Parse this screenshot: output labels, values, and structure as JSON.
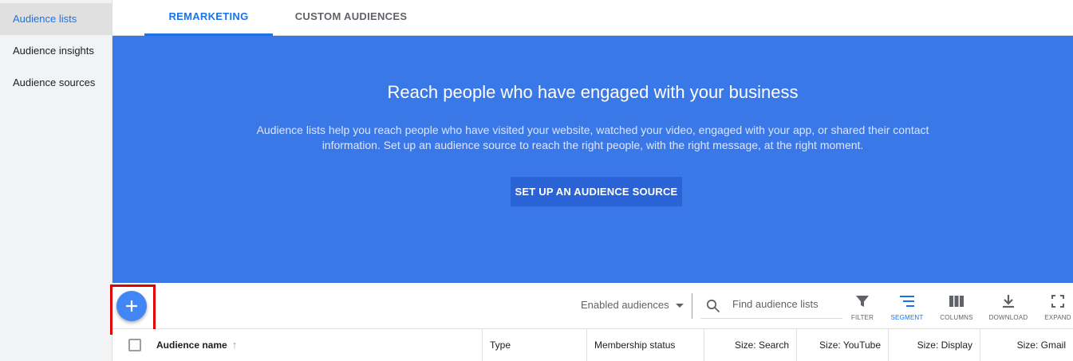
{
  "sidebar": {
    "items": [
      {
        "label": "Audience lists"
      },
      {
        "label": "Audience insights"
      },
      {
        "label": "Audience sources"
      }
    ]
  },
  "tabs": [
    {
      "label": "REMARKETING"
    },
    {
      "label": "CUSTOM AUDIENCES"
    }
  ],
  "hero": {
    "title": "Reach people who have engaged with your business",
    "description": "Audience lists help you reach people who have visited your website, watched your video, engaged with your app, or shared their contact information. Set up an audience source to reach the right people, with the right message, at the right moment.",
    "button_label": "SET UP AN AUDIENCE SOURCE"
  },
  "toolbar": {
    "filter_select": "Enabled audiences",
    "search_placeholder": "Find audience lists",
    "tools": [
      {
        "label": "FILTER",
        "icon": "filter-icon"
      },
      {
        "label": "SEGMENT",
        "icon": "segment-icon"
      },
      {
        "label": "COLUMNS",
        "icon": "columns-icon"
      },
      {
        "label": "DOWNLOAD",
        "icon": "download-icon"
      },
      {
        "label": "EXPAND",
        "icon": "expand-icon"
      }
    ]
  },
  "table": {
    "columns": [
      "Audience name",
      "Type",
      "Membership status",
      "Size: Search",
      "Size: YouTube",
      "Size: Display",
      "Size: Gmail"
    ]
  },
  "colors": {
    "accent": "#1a73e8",
    "hero_bg": "#3b78e7",
    "highlight": "#e00000"
  }
}
